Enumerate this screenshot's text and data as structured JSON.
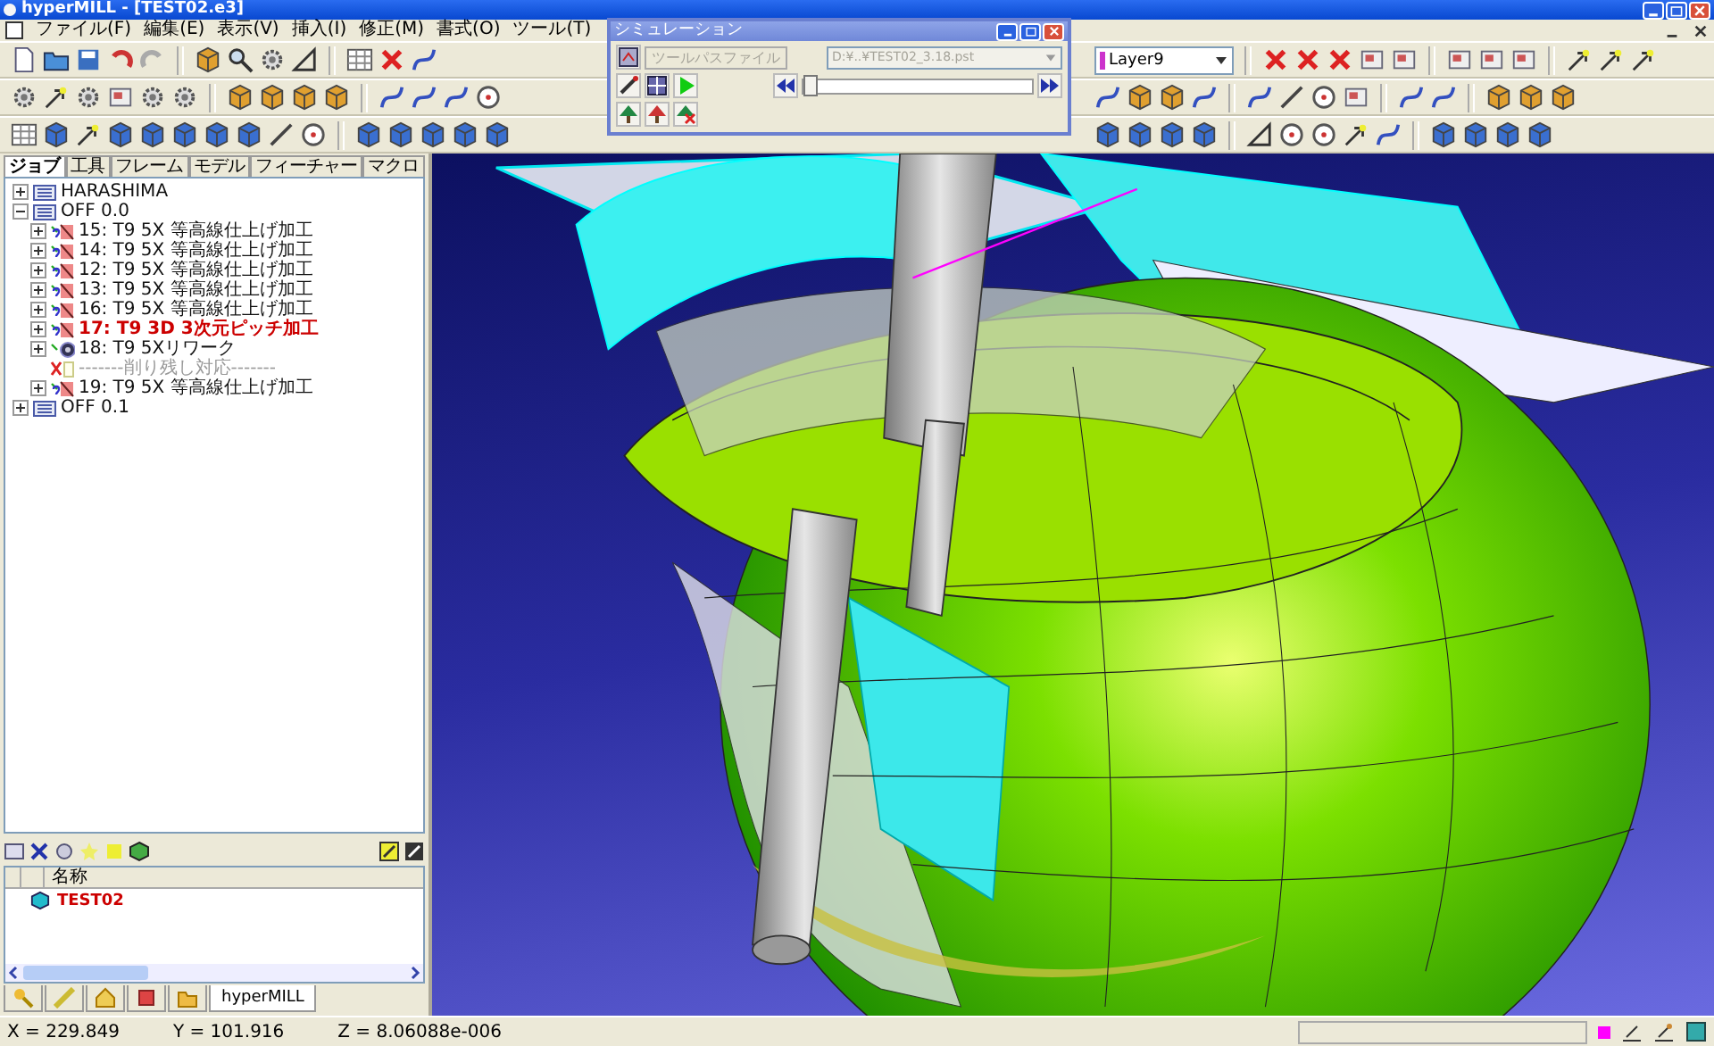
{
  "window": {
    "title": "hyperMILL - [TEST02.e3]"
  },
  "menu": [
    "ファイル(F)",
    "編集(E)",
    "表示(V)",
    "挿入(I)",
    "修正(M)",
    "書式(O)",
    "ツール(T)"
  ],
  "layer": {
    "value": "Layer9"
  },
  "simulation": {
    "title": "シミュレーション",
    "toolpath_button": {
      "label": "ツールパスファイル",
      "disabled": true
    },
    "file_field": {
      "value": "D:¥..¥TEST02_3.18.pst",
      "disabled": true
    },
    "slider": {
      "level": 0
    }
  },
  "tabs": [
    {
      "label": "ジョブ",
      "selected": true
    },
    {
      "label": "工具",
      "selected": false
    },
    {
      "label": "フレーム",
      "selected": false
    },
    {
      "label": "モデル",
      "selected": false
    },
    {
      "label": "フィーチャー",
      "selected": false
    },
    {
      "label": "マクロ",
      "selected": false
    }
  ],
  "tree": [
    {
      "label": "HARASHIMA",
      "kind": "list",
      "expanded": false,
      "selected": false
    },
    {
      "label": "OFF 0.0",
      "kind": "list",
      "expanded": true,
      "selected": false,
      "children": [
        {
          "label": "15: T9 5X 等高線仕上げ加工",
          "kind": "job",
          "expanded": false,
          "selected": false
        },
        {
          "label": "14: T9 5X 等高線仕上げ加工",
          "kind": "job",
          "expanded": false,
          "selected": false
        },
        {
          "label": "12: T9 5X 等高線仕上げ加工",
          "kind": "job",
          "expanded": false,
          "selected": false
        },
        {
          "label": "13: T9 5X 等高線仕上げ加工",
          "kind": "job",
          "expanded": false,
          "selected": false
        },
        {
          "label": "16: T9 5X 等高線仕上げ加工",
          "kind": "job",
          "expanded": false,
          "selected": false
        },
        {
          "label": "17: T9 3D 3次元ピッチ加工",
          "kind": "job",
          "expanded": false,
          "selected": true
        },
        {
          "label": "18: T9 5Xリワーク",
          "kind": "rework",
          "expanded": false,
          "selected": false
        },
        {
          "label": "-------削り残し対応-------",
          "kind": "comment",
          "selected": false
        },
        {
          "label": "19: T9 5X 等高線仕上げ加工",
          "kind": "job",
          "expanded": false,
          "selected": false
        }
      ]
    },
    {
      "label": "OFF 0.1",
      "kind": "list",
      "expanded": false,
      "selected": false
    }
  ],
  "objects": {
    "columns": [
      "名称"
    ],
    "rows": [
      {
        "name": "TEST02",
        "selected": false
      }
    ]
  },
  "bottom_tabs": [
    {
      "kind": "key",
      "selected": false
    },
    {
      "kind": "ruler",
      "selected": false
    },
    {
      "kind": "house",
      "selected": false
    },
    {
      "kind": "stop",
      "selected": false
    },
    {
      "kind": "folder",
      "selected": false
    },
    {
      "kind": "text",
      "label": "hyperMILL",
      "selected": true
    }
  ],
  "status_bar": {
    "x": "X = 229.849",
    "y": "Y = 101.916",
    "z": "Z = 8.06088e-006"
  }
}
